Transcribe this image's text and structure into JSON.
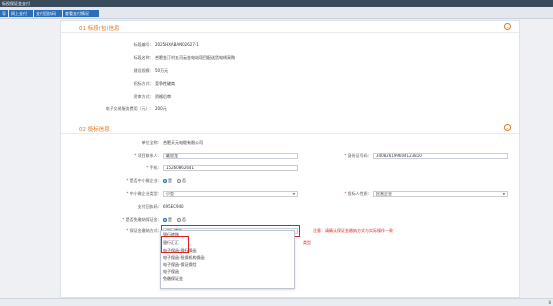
{
  "window": {
    "title": "标投保证金支付"
  },
  "tabs": [
    "导",
    "网上支付",
    "支付回执码",
    "查看支付情况"
  ],
  "section1": {
    "title": "01 标段(包)信息",
    "fields": [
      {
        "label": "标段编号:",
        "value": "2025HXABAN02627-1"
      },
      {
        "label": "标段名称:",
        "value": "合肥金汀村五河云金电站项目配送货电线采购"
      },
      {
        "label": "建设规模:",
        "value": "50万元"
      },
      {
        "label": "招标方式:",
        "value": "竞争性磋商"
      },
      {
        "label": "资审方式:",
        "value": "资格后审"
      },
      {
        "label": "电子交易服务费用（元）:",
        "value": "200元"
      }
    ]
  },
  "section2": {
    "title": "02 投标信息",
    "company_label": "单位全称:",
    "company_value": "合肥天元电缆有限公司",
    "contact_label": "项目联系人:",
    "contact_value": "戴思龙",
    "idcard_label": "身份证号码:",
    "idcard_value": "340826199604123810",
    "phone_label": "手机:",
    "phone_value": "15260862641",
    "sme_label": "是否中小微企业:",
    "sme_yes": "是",
    "sme_no": "否",
    "size_label": "中小微企业类型:",
    "size_value": "小型",
    "bidder_type_label": "投标人性质:",
    "bidder_type_value": "民营企业",
    "paycode_label": "支付回执码:",
    "paycode_value": "695EC940",
    "exempt_label": "是否免缴纳保证金:",
    "exempt_yes": "是",
    "exempt_no": "否",
    "deposit_label": "保证金缴纳方式:",
    "deposit_value": "银行转账",
    "warning": "注意：请确认保证金缴纳方式与实际操作一致",
    "warning_tail": "类型"
  },
  "dropdown_options": [
    "银行转账",
    "银行汇汇",
    "电子保函-银行保函",
    "电子保函-担保机构保函",
    "电子保函-保证保险",
    "电子保函",
    "免缴保证金"
  ],
  "status": {
    "text": "8"
  }
}
